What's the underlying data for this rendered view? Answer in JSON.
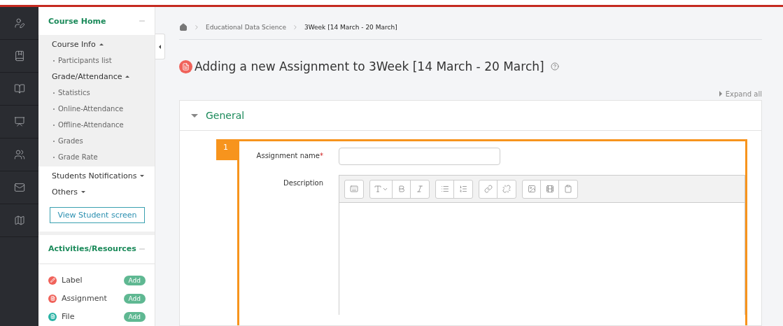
{
  "sidebar": {
    "course_home": {
      "title": "Course Home",
      "expanded": true,
      "sections": [
        {
          "label": "Course Info",
          "expanded": true,
          "children": [
            {
              "label": "Participants list"
            }
          ]
        },
        {
          "label": "Grade/Attendance",
          "expanded": true,
          "children": [
            {
              "label": "Statistics"
            },
            {
              "label": "Online-Attendance"
            },
            {
              "label": "Offline-Attendance"
            },
            {
              "label": "Grades"
            },
            {
              "label": "Grade Rate"
            }
          ]
        },
        {
          "label": "Students Notifications",
          "expanded": false
        },
        {
          "label": "Others",
          "expanded": false
        }
      ],
      "button": "View Student screen"
    },
    "activities": {
      "title": "Activities/Resources",
      "expanded": true,
      "items": [
        {
          "label": "Label",
          "color": "#f0625a",
          "button": "Add"
        },
        {
          "label": "Assignment",
          "color": "#f0625a",
          "button": "Add"
        },
        {
          "label": "File",
          "color": "#27b2a4",
          "button": "Add"
        }
      ]
    }
  },
  "breadcrumb": [
    "Educational Data Science",
    "3Week [14 March - 20 March]"
  ],
  "page_title": "Adding a new Assignment to 3Week [14 March - 20 March]",
  "expand_all": "Expand all",
  "section": {
    "title": "General",
    "expanded": true,
    "step": "1",
    "fields": [
      {
        "label": "Assignment name",
        "required_mark": "*",
        "kind": "text"
      },
      {
        "label": "Description",
        "kind": "editor"
      }
    ]
  }
}
